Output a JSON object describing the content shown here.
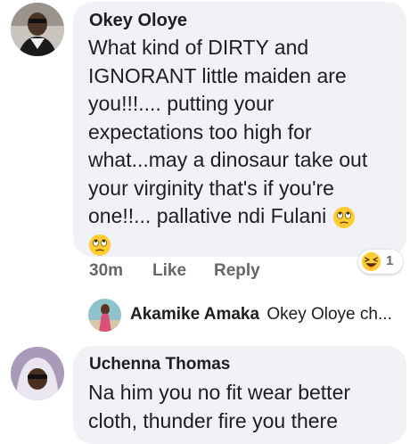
{
  "comments": [
    {
      "author": "Okey Oloye",
      "text_lines": [
        "What kind of DIRTY and",
        "IGNORANT little maiden are",
        "you!!!.... putting your",
        "expectations too high for",
        "what...may a dinosaur take out",
        "your virginity that's if you're",
        "one!!... pallative ndi Fulani"
      ],
      "time": "30m",
      "like_label": "Like",
      "reply_label": "Reply",
      "reaction_count": "1",
      "reaction_icon": "laughing-emoji-icon",
      "inline_emoji_icon": "eye-roll-emoji-icon"
    },
    {
      "author": "Uchenna Thomas",
      "text_lines": [
        "Na him you no fit wear better",
        "cloth, thunder fire you there"
      ]
    }
  ],
  "reply_preview": {
    "author": "Akamike Amaka",
    "snippet": "Okey Oloye ch..."
  },
  "colors": {
    "bubble": "#f0f2f5",
    "text": "#1c1e21",
    "muted": "#65676b",
    "emoji_yellow": "#ffcc33"
  }
}
